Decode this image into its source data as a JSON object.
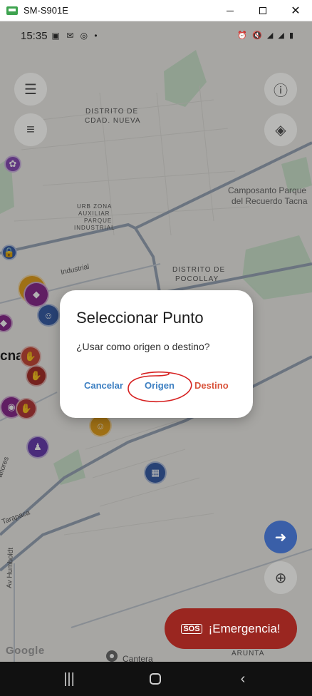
{
  "window": {
    "title": "SM-S901E"
  },
  "status_bar": {
    "time": "15:35",
    "left_icons": "▣ ✉ ◎ •",
    "right_icons": "⏰ 🔇 ◢ ◢ ▮"
  },
  "map": {
    "labels": {
      "distrito_ciudad_nueva": "DISTRITO DE CDAD. NUEVA",
      "urb_zona": "URB ZONA AUXILIAR PARQUE INDUSTRIAL",
      "camposanto_1": "Camposanto Parque",
      "camposanto_2": "del Recuerdo Tacna",
      "industrial": "Industrial",
      "pocollay_1": "DISTRITO DE",
      "pocollay_2": "POCOLLAY",
      "tacna": "cna",
      "flores": "aflores",
      "tarapaca": "Tarapaca",
      "humboldt": "Av Humboldt",
      "aruntu": "ARUNTA",
      "cantera": "Cantera",
      "google": "Google"
    }
  },
  "buttons": {
    "sos_badge": "SOS",
    "sos_label": "¡Emergencia!"
  },
  "dialog": {
    "title": "Seleccionar Punto",
    "message": "¿Usar como origen o destino?",
    "cancel": "Cancelar",
    "origin": "Origen",
    "destination": "Destino"
  },
  "colors": {
    "accent_blue": "#3c7fc2",
    "destino_red": "#d9533b",
    "sos_red": "#9a2620",
    "nav_blue": "#3a5fa8",
    "annotation_red": "#d62020"
  }
}
